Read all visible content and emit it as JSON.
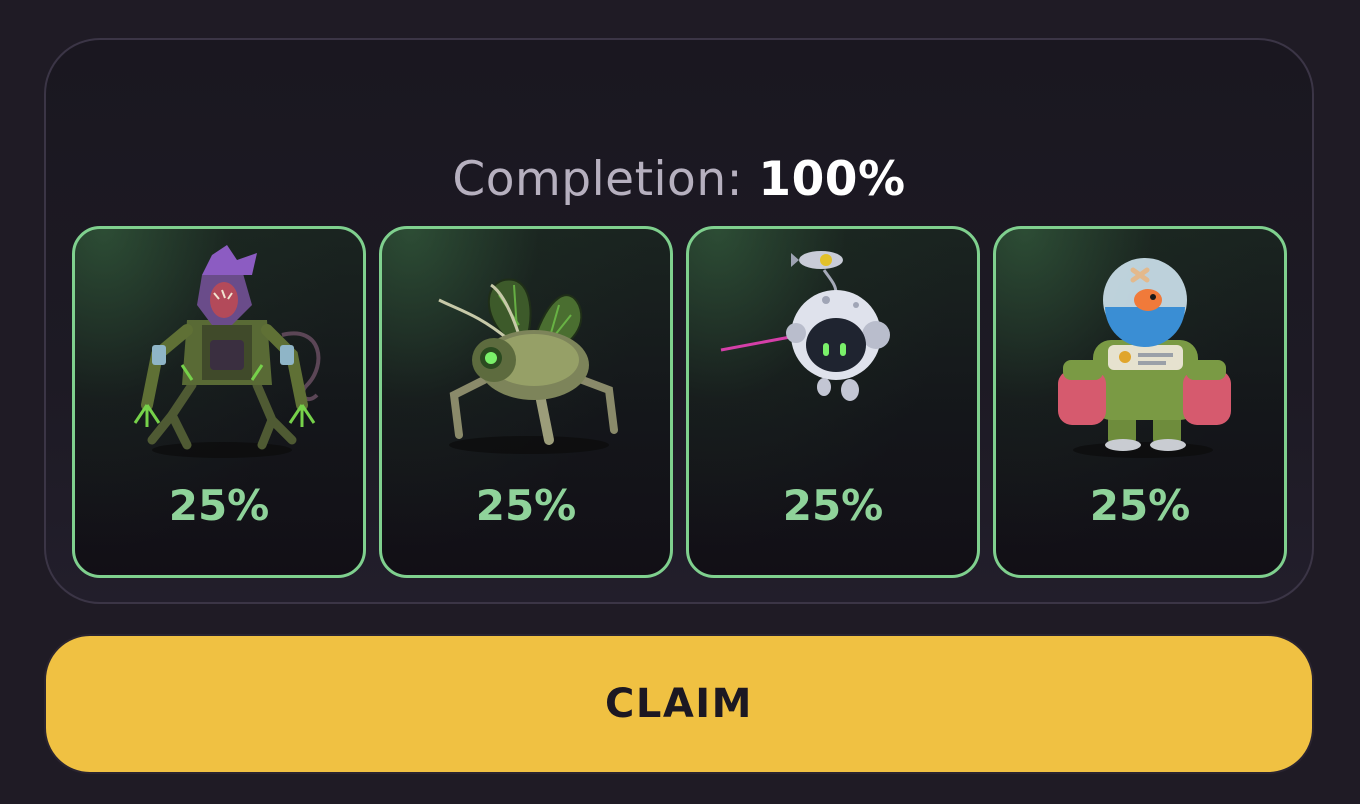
{
  "completion": {
    "label": "Completion:",
    "value": "100%",
    "progress_fraction": 1.0
  },
  "cards": [
    {
      "icon": "mutant-creature-icon",
      "percent": "25%"
    },
    {
      "icon": "robot-bug-icon",
      "percent": "25%"
    },
    {
      "icon": "space-drone-icon",
      "percent": "25%"
    },
    {
      "icon": "aquarium-mech-icon",
      "percent": "25%"
    }
  ],
  "claim_button": {
    "label": "CLAIM"
  },
  "colors": {
    "background": "#1f1b25",
    "card_border": "#7fd08e",
    "percent_text": "#8fd39a",
    "claim_button": "#f0c142"
  }
}
